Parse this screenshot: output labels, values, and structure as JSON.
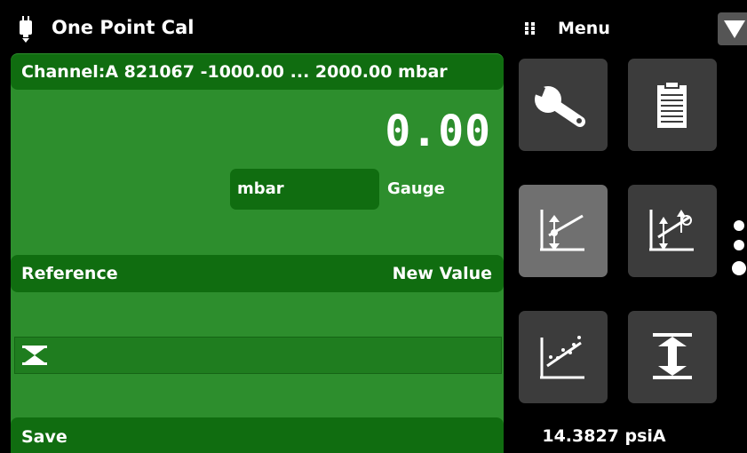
{
  "header": {
    "title": "One Point Cal",
    "title_icon": "sensor-icon",
    "menu_label": "Menu",
    "menu_icon": "grip-icon",
    "dropdown_icon": "triangle-down-icon"
  },
  "panel": {
    "channel": "Channel:A 821067 -1000.00 ... 2000.00 mbar",
    "reading": "0.00",
    "unit": "mbar",
    "mode": "Gauge",
    "reference_label": "Reference",
    "new_value_label": "New Value",
    "entry_value": "",
    "save_label": "Save",
    "colors": {
      "panel": "#2d8e2d",
      "band": "#106d10"
    }
  },
  "menu_tiles": [
    {
      "icon": "wrench-icon",
      "selected": false
    },
    {
      "icon": "clipboard-icon",
      "selected": false
    },
    {
      "icon": "one-point-cal-icon",
      "selected": true
    },
    {
      "icon": "two-point-cal-icon",
      "selected": false
    },
    {
      "icon": "linearization-icon",
      "selected": false
    },
    {
      "icon": "zero-icon",
      "selected": false
    }
  ],
  "pager": {
    "pages": 3,
    "current": 3
  },
  "status": {
    "barometric_pressure": "14.3827 psiA"
  }
}
